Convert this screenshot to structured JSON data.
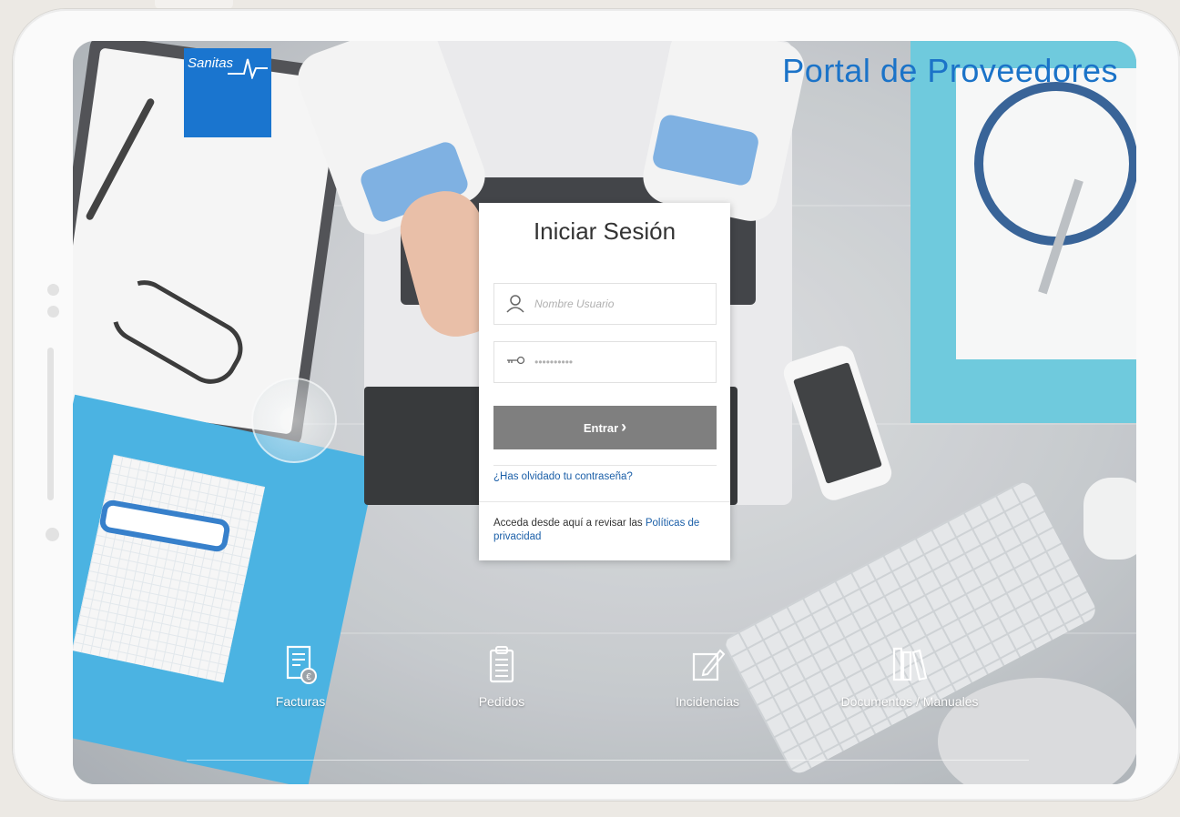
{
  "brand": {
    "logo_text": "Sanitas",
    "portal_title": "Portal de Proveedores",
    "color_primary": "#1b73c8"
  },
  "login": {
    "title": "Iniciar Sesión",
    "username_placeholder": "Nombre Usuario",
    "password_placeholder": "••••••••••",
    "username_icon": "user-icon",
    "password_icon": "key-icon",
    "submit_label": "Entrar",
    "forgot_password": "¿Has olvidado tu contraseña?",
    "privacy_text": "Acceda desde aquí a revisar las ",
    "privacy_link": "Políticas de privacidad"
  },
  "nav": [
    {
      "label": "Facturas",
      "icon": "invoice-icon"
    },
    {
      "label": "Pedidos",
      "icon": "clipboard-icon"
    },
    {
      "label": "Incidencias",
      "icon": "edit-icon"
    },
    {
      "label": "Documentos / Manuales",
      "icon": "books-icon"
    }
  ]
}
